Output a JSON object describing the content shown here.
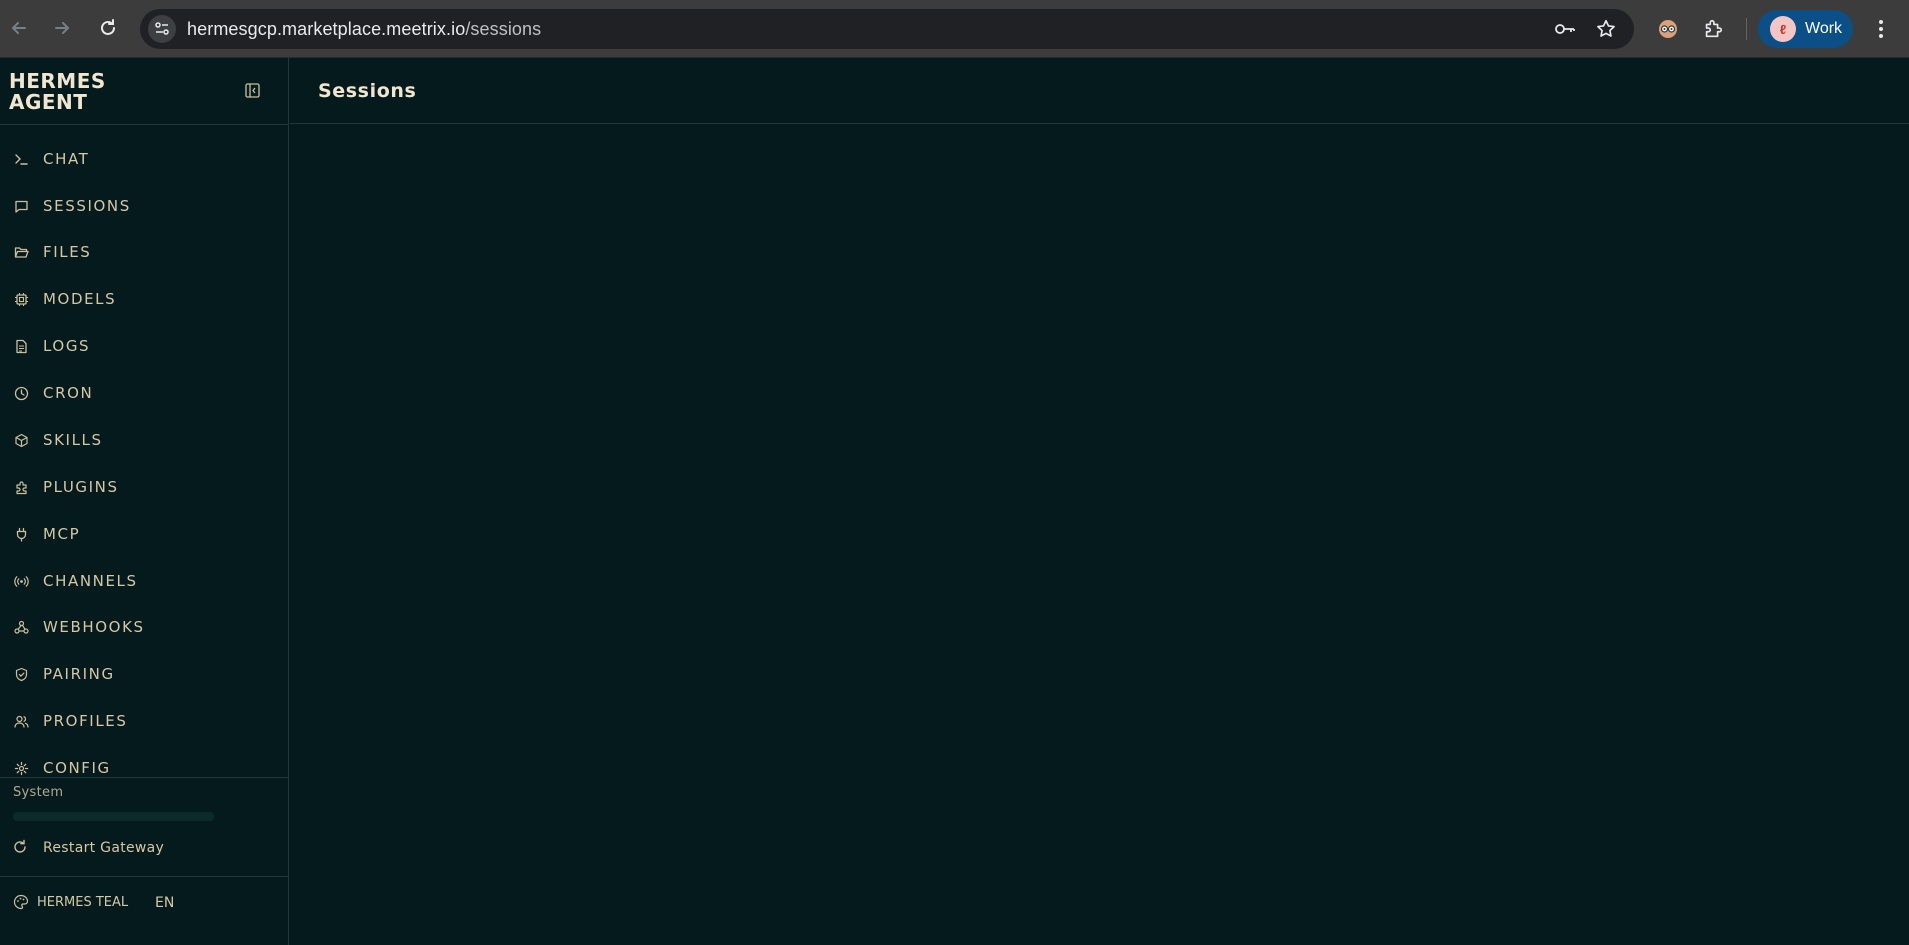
{
  "browser": {
    "url_host": "hermesgcp.marketplace.meetrix.io",
    "url_path": "/sessions",
    "profile_label": "Work"
  },
  "sidebar": {
    "brand_line1": "HERMES",
    "brand_line2": "AGENT",
    "items": [
      {
        "label": "CHAT",
        "icon": "terminal-icon"
      },
      {
        "label": "SESSIONS",
        "icon": "message-square-icon"
      },
      {
        "label": "FILES",
        "icon": "folder-open-icon"
      },
      {
        "label": "MODELS",
        "icon": "cpu-icon"
      },
      {
        "label": "LOGS",
        "icon": "file-text-icon"
      },
      {
        "label": "CRON",
        "icon": "clock-icon"
      },
      {
        "label": "SKILLS",
        "icon": "package-icon"
      },
      {
        "label": "PLUGINS",
        "icon": "puzzle-icon"
      },
      {
        "label": "MCP",
        "icon": "plug-icon"
      },
      {
        "label": "CHANNELS",
        "icon": "radio-icon"
      },
      {
        "label": "WEBHOOKS",
        "icon": "webhook-icon"
      },
      {
        "label": "PAIRING",
        "icon": "shield-check-icon"
      },
      {
        "label": "PROFILES",
        "icon": "users-icon"
      },
      {
        "label": "CONFIG",
        "icon": "gear-icon"
      }
    ],
    "system_label": "System",
    "restart_label": "Restart Gateway",
    "theme_label": "HERMES TEAL",
    "language": "EN"
  },
  "main": {
    "title": "Sessions"
  },
  "colors": {
    "background": "#041a1c",
    "accent_text": "#d6c7a6",
    "divider": "#1e3a37"
  }
}
